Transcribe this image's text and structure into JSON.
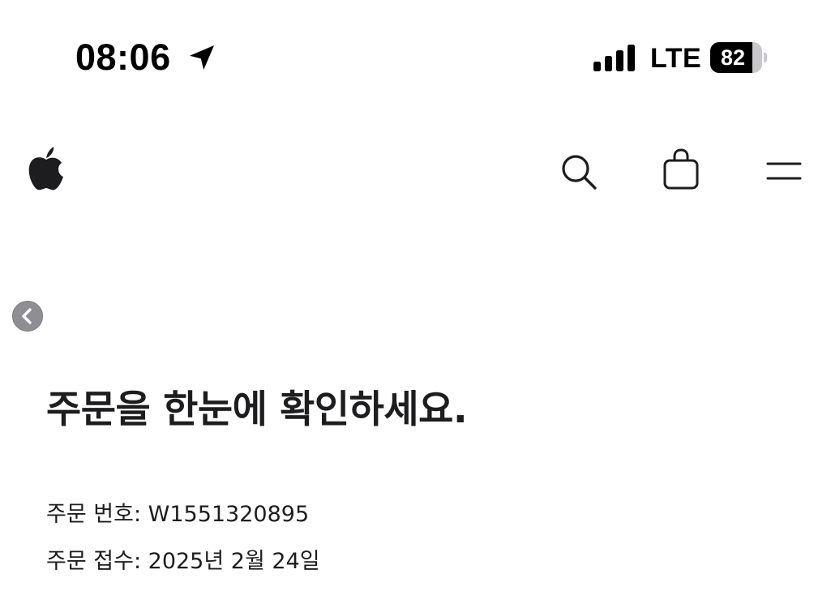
{
  "status_bar": {
    "time": "08:06",
    "network": "LTE",
    "battery_percent": 82,
    "battery_label": "82",
    "icons": [
      "location-arrow-icon",
      "cellular-signal-icon",
      "battery-icon"
    ]
  },
  "nav": {
    "icons": [
      "apple-logo-icon",
      "search-icon",
      "shopping-bag-icon",
      "menu-icon"
    ]
  },
  "back": {
    "icon": "chevron-left-icon"
  },
  "page": {
    "title": "주문을 한눈에 확인하세요.",
    "order_number_label": "주문 번호:",
    "order_number_value": "W1551320895",
    "order_date_label": "주문 접수:",
    "order_date_value": "2025년 2월 24일"
  }
}
